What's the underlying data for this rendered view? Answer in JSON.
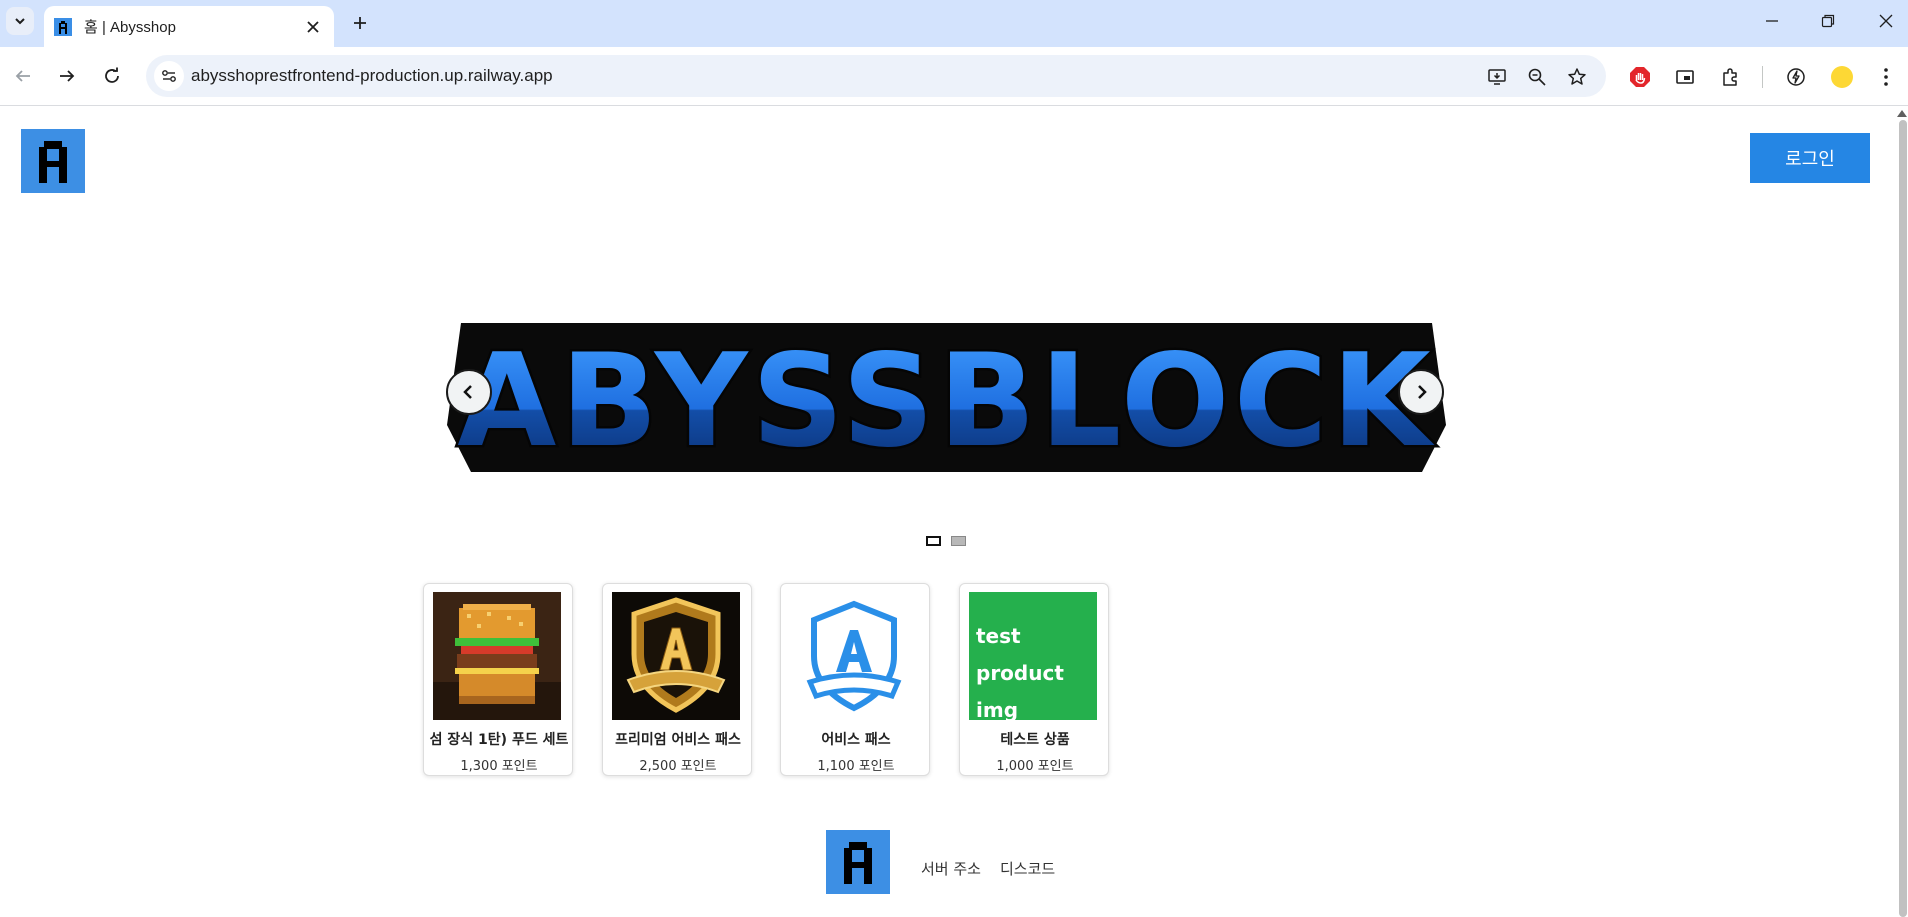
{
  "browser": {
    "tab": {
      "title": "홈 | Abysshop"
    },
    "url": "abysshoprestfrontend-production.up.railway.app",
    "colors": {
      "tabstrip": "#d3e3fd",
      "omnibox": "#edf2fa"
    },
    "icons": [
      "tab-search-icon",
      "close-icon",
      "plus-icon",
      "minimize-icon",
      "restore-icon",
      "window-close-icon",
      "back-icon",
      "forward-icon",
      "reload-icon",
      "site-info-icon",
      "install-app-icon",
      "zoom-icon",
      "star-icon",
      "adblock-icon",
      "pip-icon",
      "extensions-icon",
      "performance-icon",
      "profile-avatar-icon",
      "menu-icon"
    ]
  },
  "header": {
    "login_label": "로그인",
    "colors": {
      "logo_bg": "#3d8fe4",
      "login_bg": "#2586e4"
    }
  },
  "carousel": {
    "banner_text": "ABYSSBLOCK",
    "slide_count": 2,
    "active_slide": 1,
    "colors": {
      "banner_light": "#3f9cff",
      "banner_dark": "#0e48a8",
      "outline": "#0a0a0a"
    }
  },
  "products": [
    {
      "name": "섬 장식 1탄) 푸드 세트",
      "price": "1,300 포인트",
      "image": "burger"
    },
    {
      "name": "프리미엄 어비스 패스",
      "price": "2,500 포인트",
      "image": "gold-shield"
    },
    {
      "name": "어비스 패스",
      "price": "1,100 포인트",
      "image": "blue-shield"
    },
    {
      "name": "테스트 상품",
      "price": "1,000 포인트",
      "image_text": "test product img",
      "image_color": "#25b04d"
    }
  ],
  "footer": {
    "links": [
      "서버 주소",
      "디스코드"
    ]
  }
}
